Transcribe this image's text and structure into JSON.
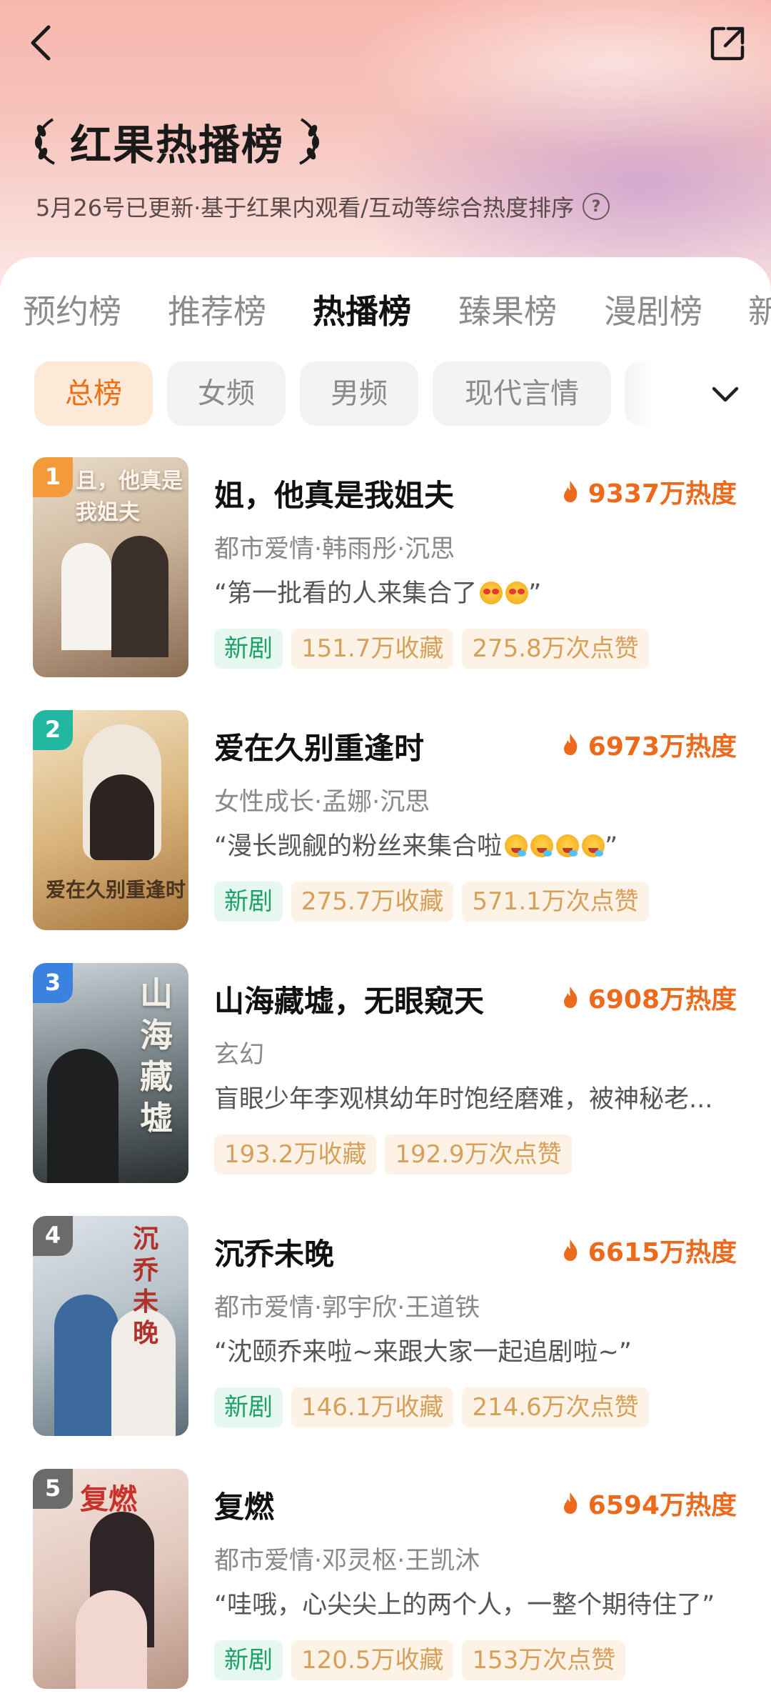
{
  "header": {
    "title": "红果热播榜",
    "subtitle": "5月26号已更新·基于红果内观看/互动等综合热度排序",
    "help_symbol": "?",
    "back_icon": "chevron-left-icon",
    "share_icon": "share-icon"
  },
  "tabs": [
    {
      "label": "预约榜"
    },
    {
      "label": "推荐榜"
    },
    {
      "label": "热播榜",
      "active": true
    },
    {
      "label": "臻果榜"
    },
    {
      "label": "漫剧榜"
    },
    {
      "label": "新"
    }
  ],
  "filters": [
    {
      "label": "总榜",
      "active": true
    },
    {
      "label": "女频"
    },
    {
      "label": "男频"
    },
    {
      "label": "现代言情"
    }
  ],
  "colors": {
    "accent_orange": "#ec6a1c",
    "new_tag_green": "#1f9f6a",
    "rank1": "#f39a3a",
    "rank2": "#22b7a0",
    "rank3": "#3b82e0",
    "rank4_5": "#6b6b6b"
  },
  "list": [
    {
      "rank": "1",
      "poster_text": "且，他真是我姐夫",
      "name": "姐，他真是我姐夫",
      "heat": "9337万热度",
      "meta": "都市爱情·韩雨彤·沉思",
      "quote_open": "“第一批看的人来集合了",
      "quote_close": "”",
      "emojis": [
        "heart-eyes-emoji",
        "heart-eyes-emoji"
      ],
      "tags": [
        "新剧",
        "151.7万收藏",
        "275.8万次点赞"
      ]
    },
    {
      "rank": "2",
      "poster_text": "爱在久别重逢时",
      "name": "爱在久别重逢时",
      "heat": "6973万热度",
      "meta": "女性成长·孟娜·沉思",
      "quote_open": "“漫长觊觎的粉丝来集合啦",
      "quote_close": "”",
      "emojis": [
        "drooling-emoji",
        "drooling-emoji",
        "drooling-emoji",
        "drooling-emoji"
      ],
      "tags": [
        "新剧",
        "275.7万收藏",
        "571.1万次点赞"
      ]
    },
    {
      "rank": "3",
      "poster_text": "山海藏墟",
      "name": "山海藏墟，无眼窥天",
      "heat": "6908万热度",
      "meta": "玄幻",
      "quote_open": "盲眼少年李观棋幼年时饱经磨难，被神秘老...",
      "quote_close": "",
      "emojis": [],
      "tags": [
        "193.2万收藏",
        "192.9万次点赞"
      ]
    },
    {
      "rank": "4",
      "poster_text": "沉乔未晚",
      "name": "沉乔未晚",
      "heat": "6615万热度",
      "meta": "都市爱情·郭宇欣·王道铁",
      "quote_open": "“沈颐乔来啦~来跟大家一起追剧啦~”",
      "quote_close": "",
      "emojis": [],
      "tags": [
        "新剧",
        "146.1万收藏",
        "214.6万次点赞"
      ]
    },
    {
      "rank": "5",
      "poster_text": "复燃",
      "name": "复燃",
      "heat": "6594万热度",
      "meta": "都市爱情·邓灵枢·王凯沐",
      "quote_open": "“哇哦，心尖尖上的两个人，一整个期待住了”",
      "quote_close": "",
      "emojis": [],
      "tags": [
        "新剧",
        "120.5万收藏",
        "153万次点赞"
      ]
    }
  ]
}
